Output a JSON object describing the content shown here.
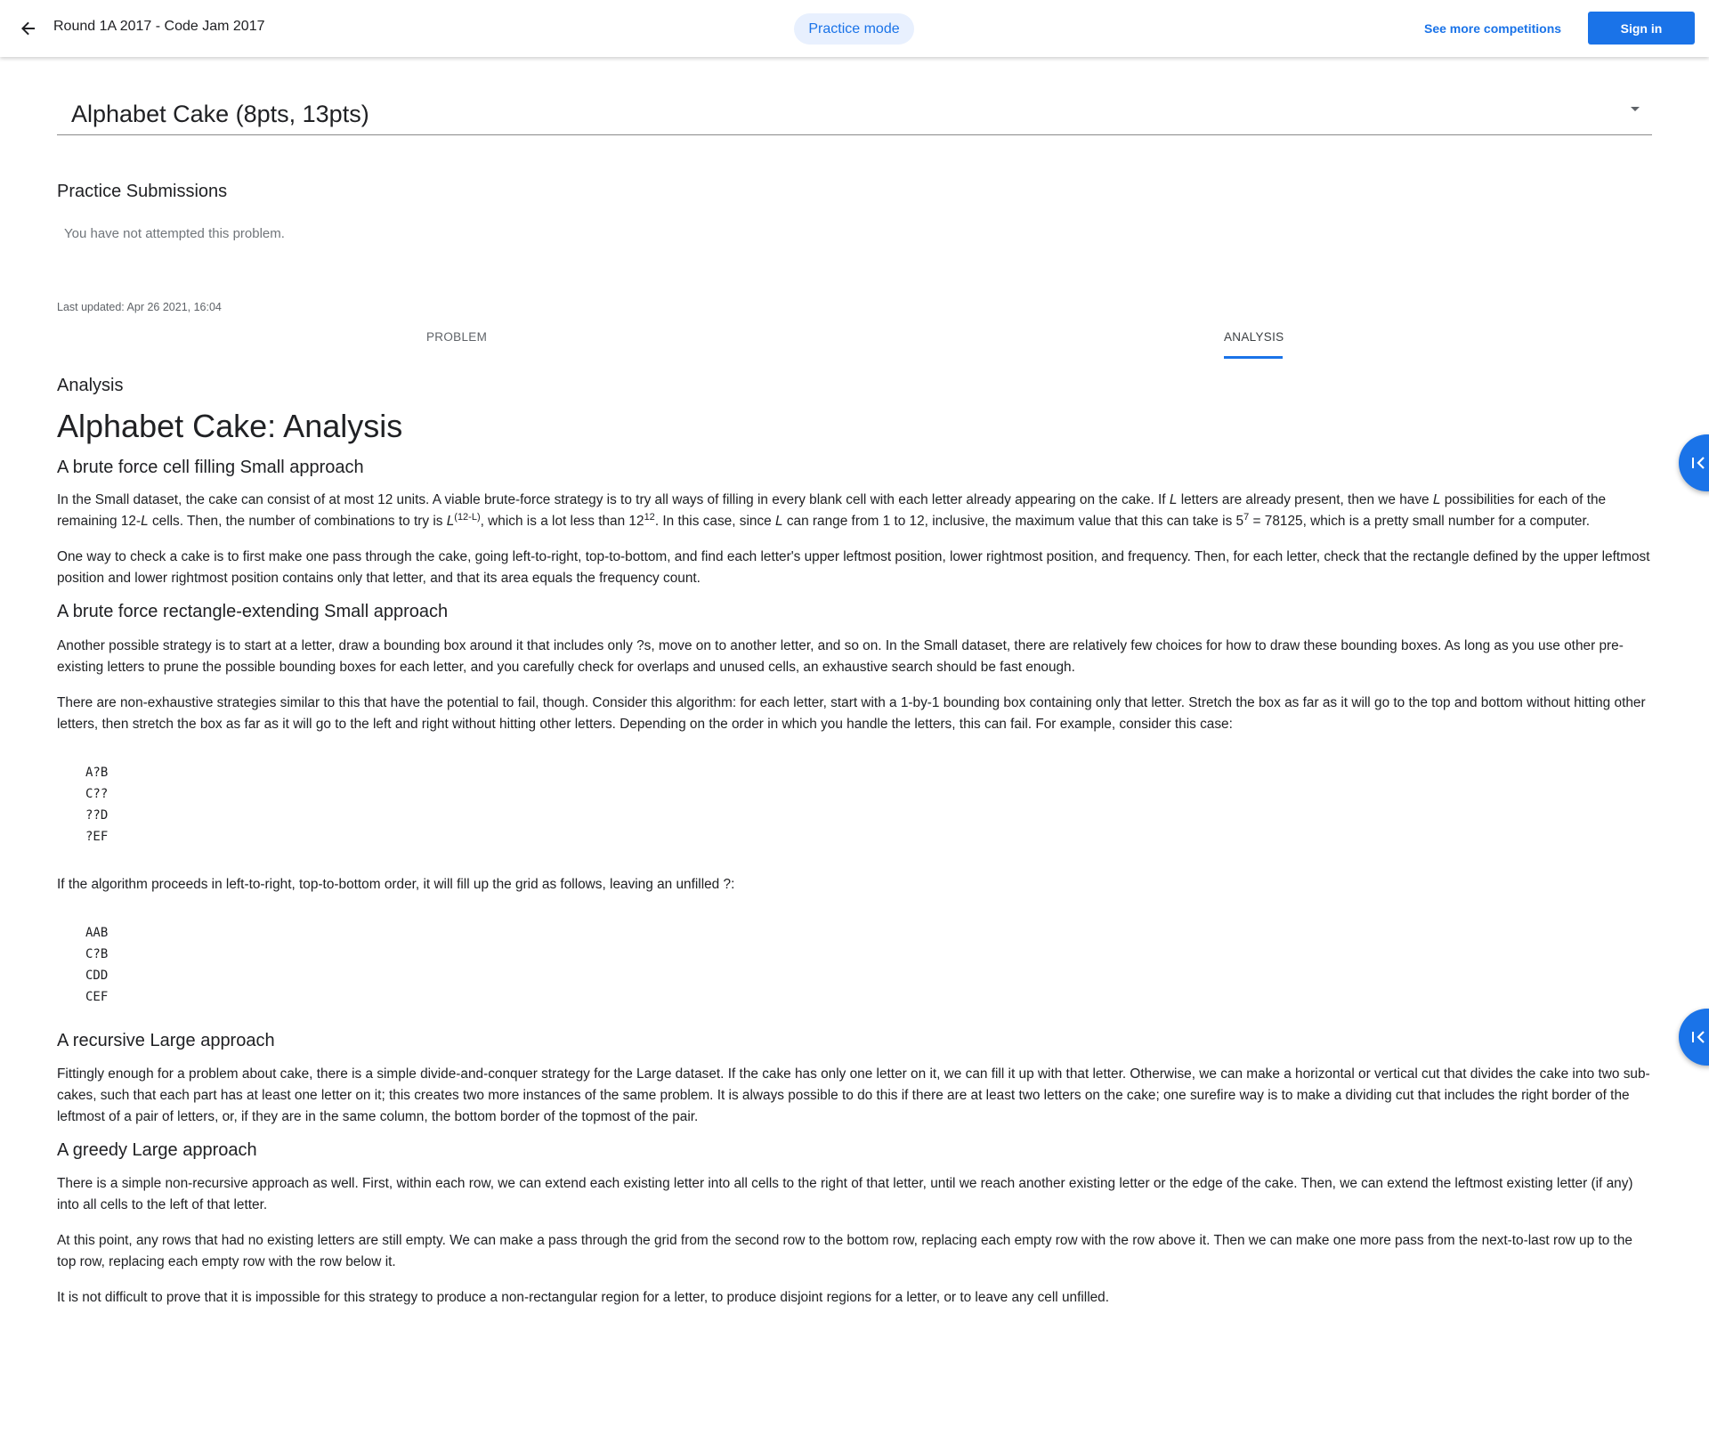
{
  "header": {
    "title": "Round 1A 2017 - Code Jam 2017",
    "mode_chip": "Practice mode",
    "more_link": "See more competitions",
    "signin_label": "Sign in"
  },
  "problem_select": {
    "value": "Alphabet Cake (8pts, 13pts)"
  },
  "submissions": {
    "heading": "Practice Submissions",
    "empty_text": "You have not attempted this problem."
  },
  "last_updated": "Last updated: Apr 26 2021, 16:04",
  "tabs": [
    {
      "label": "PROBLEM",
      "active": false
    },
    {
      "label": "ANALYSIS",
      "active": true
    }
  ],
  "content": {
    "label": "Analysis",
    "title": "Alphabet Cake: Analysis",
    "s1": {
      "heading": "A brute force cell filling Small approach",
      "p1": {
        "a": "In the Small dataset, the cake can consist of at most 12 units. A viable brute-force strategy is to try all ways of filling in every blank cell with each letter already appearing on the cake. If ",
        "L1": "L",
        "b": " letters are already present, then we have ",
        "L2": "L",
        "c": " possibilities for each of the remaining 12-",
        "L3": "L",
        "d": " cells. Then, the number of combinations to try is ",
        "L4": "L",
        "exp1": "(12-L)",
        "e": ", which is a lot less than 12",
        "exp2": "12",
        "f": ". In this case, since ",
        "L5": "L",
        "g": " can range from 1 to 12, inclusive, the maximum value that this can take is 5",
        "exp3": "7",
        "h": " = 78125, which is a pretty small number for a computer."
      },
      "p2": "One way to check a cake is to first make one pass through the cake, going left-to-right, top-to-bottom, and find each letter's upper leftmost position, lower rightmost position, and frequency. Then, for each letter, check that the rectangle defined by the upper leftmost position and lower rightmost position contains only that letter, and that its area equals the frequency count."
    },
    "s2": {
      "heading": "A brute force rectangle-extending Small approach",
      "p1": "Another possible strategy is to start at a letter, draw a bounding box around it that includes only ?s, move on to another letter, and so on. In the Small dataset, there are relatively few choices for how to draw these bounding boxes. As long as you use other pre-existing letters to prune the possible bounding boxes for each letter, and you carefully check for overlaps and unused cells, an exhaustive search should be fast enough.",
      "p2": "There are non-exhaustive strategies similar to this that have the potential to fail, though. Consider this algorithm: for each letter, start with a 1-by-1 bounding box containing only that letter. Stretch the box as far as it will go to the top and bottom without hitting other letters, then stretch the box as far as it will go to the left and right without hitting other letters. Depending on the order in which you handle the letters, this can fail. For example, consider this case:",
      "code1": [
        "A?B",
        "C??",
        "??D",
        "?EF"
      ],
      "p3": "If the algorithm proceeds in left-to-right, top-to-bottom order, it will fill up the grid as follows, leaving an unfilled ?:",
      "code2": [
        "AAB",
        "C?B",
        "CDD",
        "CEF"
      ]
    },
    "s3": {
      "heading": "A recursive Large approach",
      "p1": "Fittingly enough for a problem about cake, there is a simple divide-and-conquer strategy for the Large dataset. If the cake has only one letter on it, we can fill it up with that letter. Otherwise, we can make a horizontal or vertical cut that divides the cake into two sub-cakes, such that each part has at least one letter on it; this creates two more instances of the same problem. It is always possible to do this if there are at least two letters on the cake; one surefire way is to make a dividing cut that includes the right border of the leftmost of a pair of letters, or, if they are in the same column, the bottom border of the topmost of the pair."
    },
    "s4": {
      "heading": "A greedy Large approach",
      "p1": "There is a simple non-recursive approach as well. First, within each row, we can extend each existing letter into all cells to the right of that letter, until we reach another existing letter or the edge of the cake. Then, we can extend the leftmost existing letter (if any) into all cells to the left of that letter.",
      "p2": "At this point, any rows that had no existing letters are still empty. We can make a pass through the grid from the second row to the bottom row, replacing each empty row with the row above it. Then we can make one more pass from the next-to-last row up to the top row, replacing each empty row with the row below it.",
      "p3": "It is not difficult to prove that it is impossible for this strategy to produce a non-rectangular region for a letter, to produce disjoint regions for a letter, or to leave any cell unfilled."
    }
  },
  "side_buttons": [
    {
      "icon": "collapse-left-icon"
    },
    {
      "icon": "collapse-left-icon"
    }
  ],
  "colors": {
    "accent": "#1a73e8",
    "chip_bg": "#e8f0fe",
    "muted_text": "#5f6368"
  }
}
